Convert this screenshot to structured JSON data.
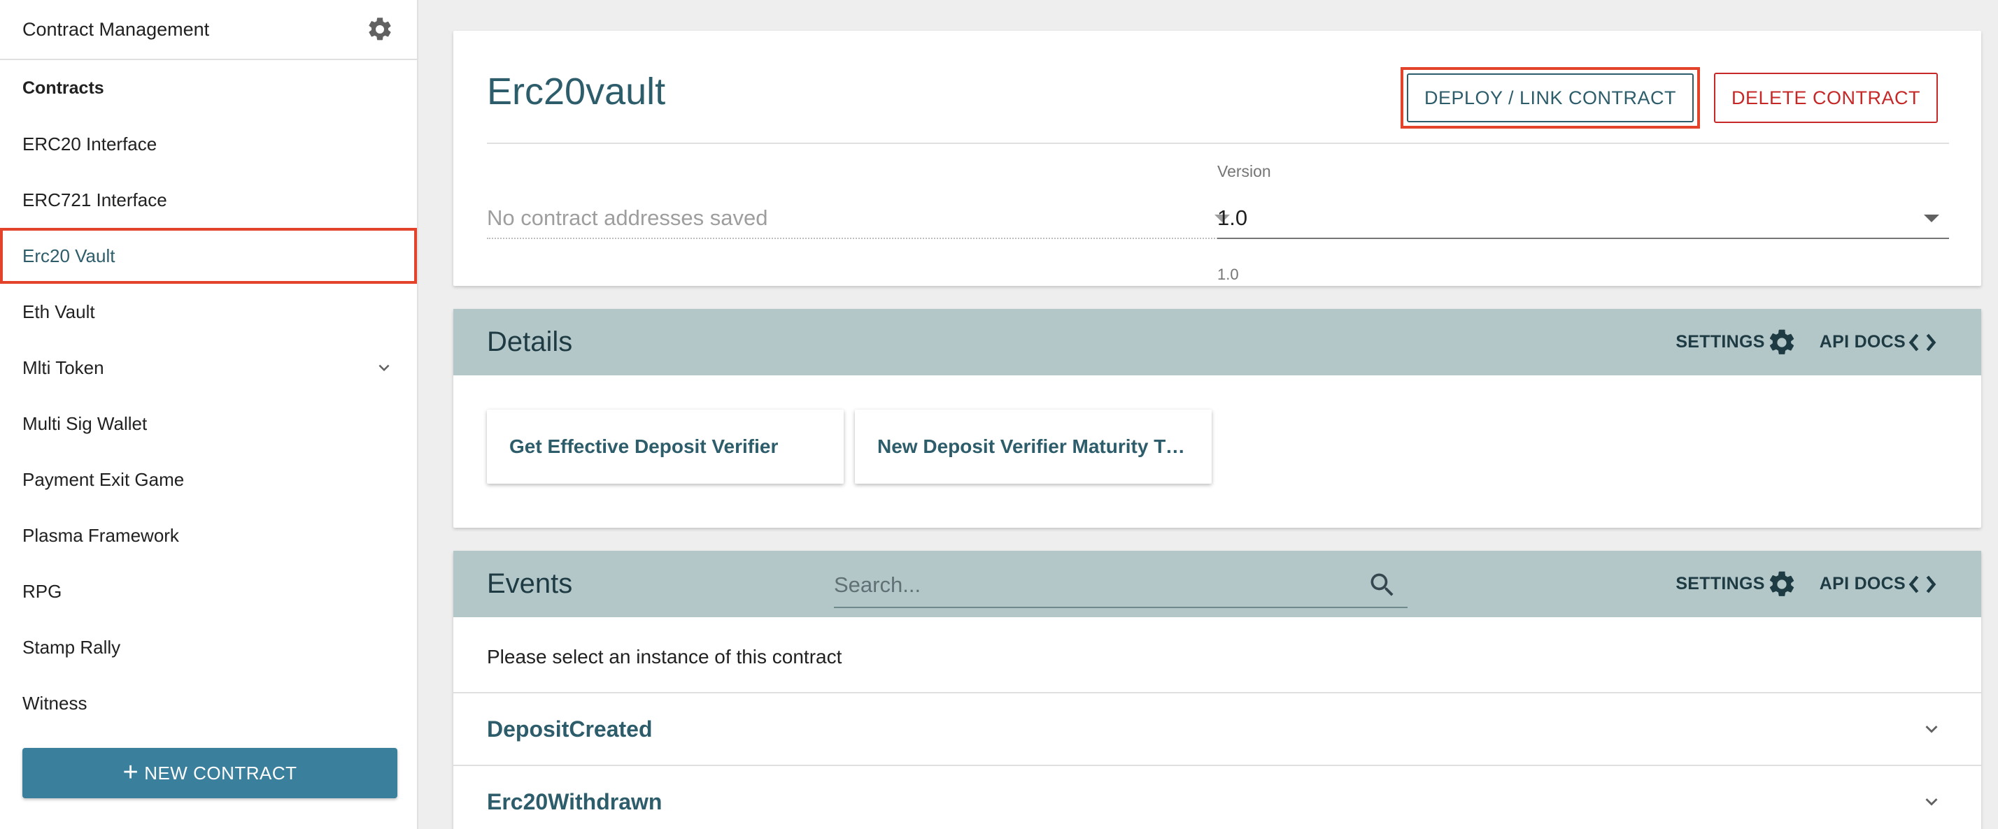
{
  "sidebar": {
    "header_title": "Contract Management",
    "section_label": "Contracts",
    "items": [
      {
        "label": "ERC20 Interface"
      },
      {
        "label": "ERC721 Interface"
      },
      {
        "label": "Erc20 Vault"
      },
      {
        "label": "Eth Vault"
      },
      {
        "label": "Mlti Token"
      },
      {
        "label": "Multi Sig Wallet"
      },
      {
        "label": "Payment Exit Game"
      },
      {
        "label": "Plasma Framework"
      },
      {
        "label": "RPG"
      },
      {
        "label": "Stamp Rally"
      },
      {
        "label": "Witness"
      }
    ],
    "active_item": "Erc20 Vault",
    "new_contract_label": "NEW CONTRACT"
  },
  "contract": {
    "title": "Erc20vault",
    "deploy_label": "DEPLOY / LINK CONTRACT",
    "delete_label": "DELETE CONTRACT",
    "address_placeholder": "No contract addresses saved",
    "version_label": "Version",
    "version_value": "1.0",
    "version_hint": "1.0"
  },
  "details": {
    "title": "Details",
    "settings_label": "SETTINGS",
    "api_docs_label": "API DOCS",
    "methods": [
      {
        "label": "Get Effective Deposit Verifier"
      },
      {
        "label": "New Deposit Verifier Maturity Timestamp"
      }
    ]
  },
  "events": {
    "title": "Events",
    "search_placeholder": "Search...",
    "settings_label": "SETTINGS",
    "api_docs_label": "API DOCS",
    "message": "Please select an instance of this contract",
    "items": [
      {
        "label": "DepositCreated"
      },
      {
        "label": "Erc20Withdrawn"
      }
    ]
  },
  "colors": {
    "accent": "#3a7f9b",
    "title_teal": "#2d5d6b",
    "section_bar": "#b4c7c8",
    "danger": "#c62828",
    "highlight": "#e2432a"
  },
  "icons": [
    "gear-icon",
    "chevron-down-icon",
    "plus-icon",
    "caret-down-icon",
    "code-icon",
    "search-icon"
  ]
}
